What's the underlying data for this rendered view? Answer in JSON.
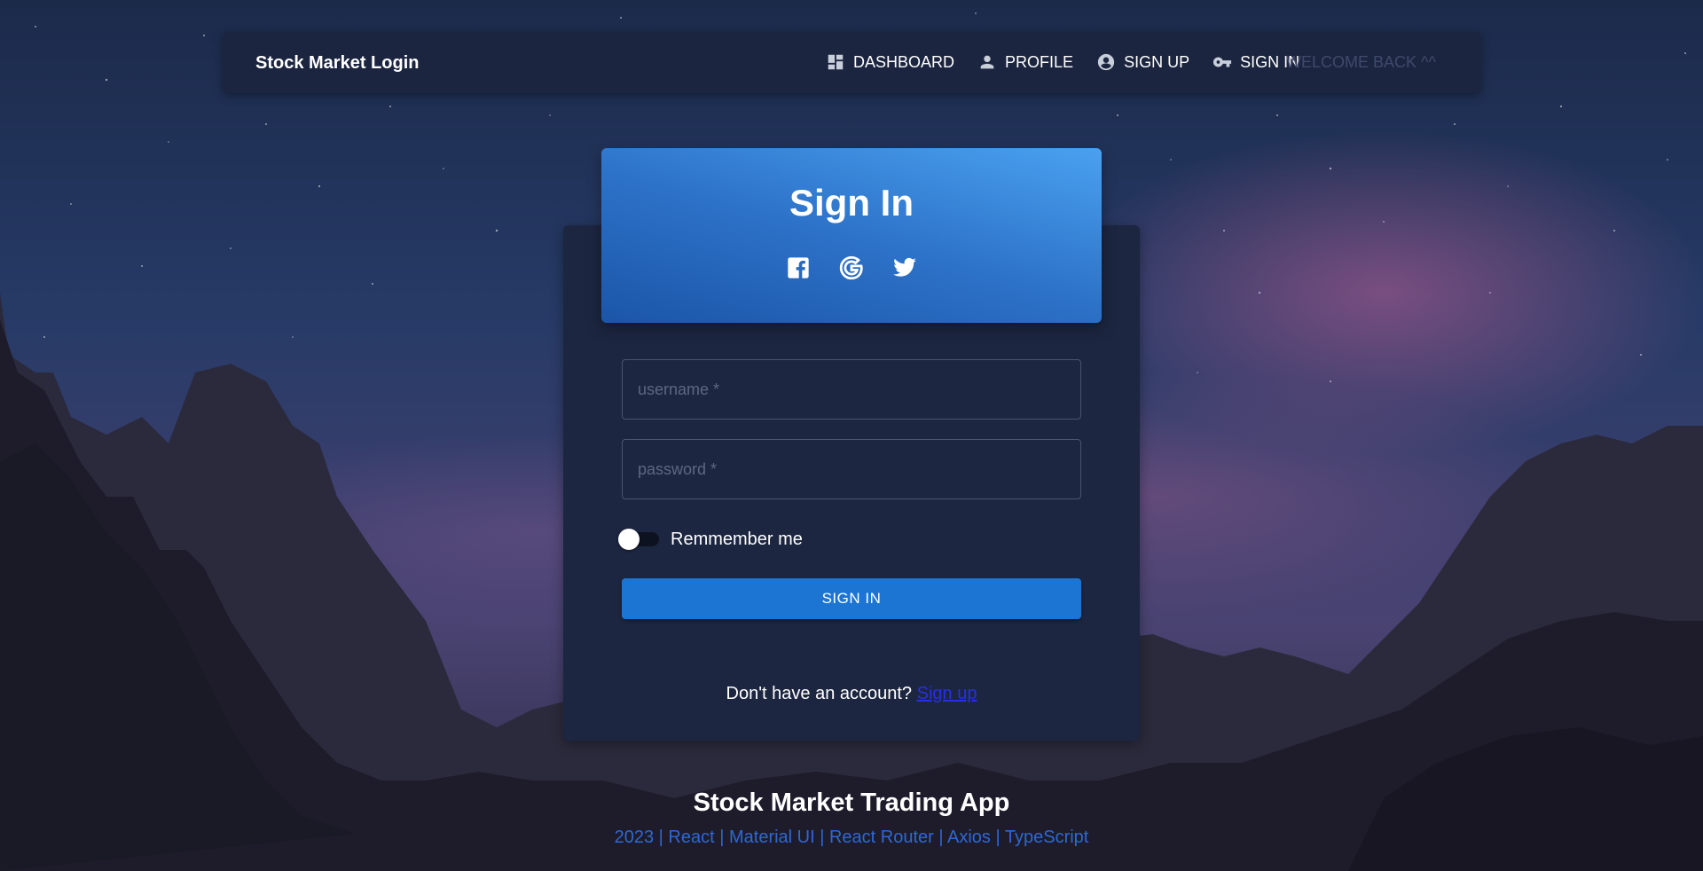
{
  "navbar": {
    "brand": "Stock Market Login",
    "links": [
      {
        "label": "DASHBOARD",
        "icon": "dashboard-icon"
      },
      {
        "label": "PROFILE",
        "icon": "person-icon"
      },
      {
        "label": "SIGN UP",
        "icon": "account-circle-icon"
      },
      {
        "label": "SIGN IN",
        "icon": "key-icon"
      }
    ],
    "welcome": "WELCOME BACK ^^"
  },
  "signin": {
    "title": "Sign In",
    "socials": [
      "facebook-icon",
      "google-icon",
      "twitter-icon"
    ],
    "username_placeholder": "username *",
    "password_placeholder": "password *",
    "remember_label": "Remmember me",
    "remember_checked": false,
    "button_label": "SIGN IN",
    "account_prompt": "Don't have an account?",
    "signup_link": "Sign up"
  },
  "footer": {
    "title": "Stock Market Trading App",
    "links": "2023 | React | Material UI | React Router | Axios | TypeScript"
  },
  "colors": {
    "header_gradient_start": "#4aa1f0",
    "header_gradient_end": "#1b55a8",
    "card_bg": "#1c2640",
    "button_bg": "#1c75d2",
    "link_color": "#2530e6",
    "footer_link_color": "#2e67d6"
  }
}
